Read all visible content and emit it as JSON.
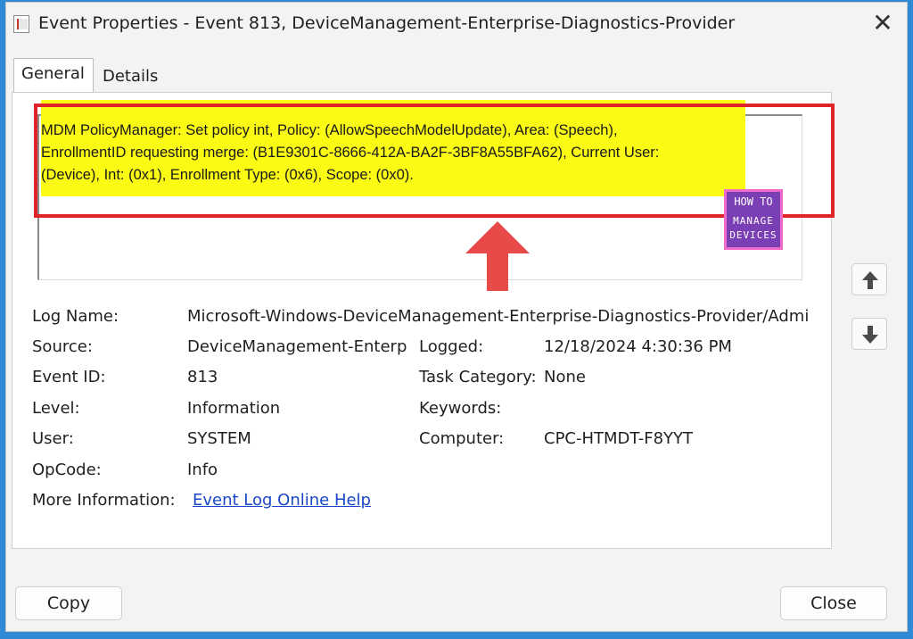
{
  "window": {
    "title": "Event Properties - Event 813, DeviceManagement-Enterprise-Diagnostics-Provider",
    "close_glyph": "✕"
  },
  "tabs": [
    {
      "label": "General",
      "selected": true
    },
    {
      "label": "Details",
      "selected": false
    }
  ],
  "description": {
    "line1": "MDM PolicyManager: Set policy int, Policy: (AllowSpeechModelUpdate), Area: (Speech),",
    "line2": "EnrollmentID requesting merge: (B1E9301C-8666-412A-BA2F-3BF8A55BFA62), Current User:",
    "line3": "(Device), Int: (0x1), Enrollment Type: (0x6), Scope: (0x0)."
  },
  "logo": {
    "top": "HOW TO",
    "middle": "MANAGE",
    "bottom": "DEVICES"
  },
  "fields": {
    "log_name": {
      "label": "Log Name:",
      "value": "Microsoft-Windows-DeviceManagement-Enterprise-Diagnostics-Provider/Admi"
    },
    "source": {
      "label": "Source:",
      "value": "DeviceManagement-Enterpr"
    },
    "logged": {
      "label": "Logged:",
      "value": "12/18/2024 4:30:36 PM"
    },
    "event_id": {
      "label": "Event ID:",
      "value": "813"
    },
    "task_category": {
      "label": "Task Category:",
      "value": "None"
    },
    "level": {
      "label": "Level:",
      "value": "Information"
    },
    "keywords": {
      "label": "Keywords:",
      "value": ""
    },
    "user": {
      "label": "User:",
      "value": "SYSTEM"
    },
    "computer": {
      "label": "Computer:",
      "value": "CPC-HTMDT-F8YYT"
    },
    "opcode": {
      "label": "OpCode:",
      "value": "Info"
    },
    "more_info": {
      "label": "More Information:",
      "link": "Event Log Online Help"
    }
  },
  "buttons": {
    "copy": "Copy",
    "close": "Close"
  },
  "colors": {
    "highlight": "#fafa14",
    "annotation_red": "#e0222a",
    "link": "#1a47c8",
    "background": "#2f8ad6"
  }
}
